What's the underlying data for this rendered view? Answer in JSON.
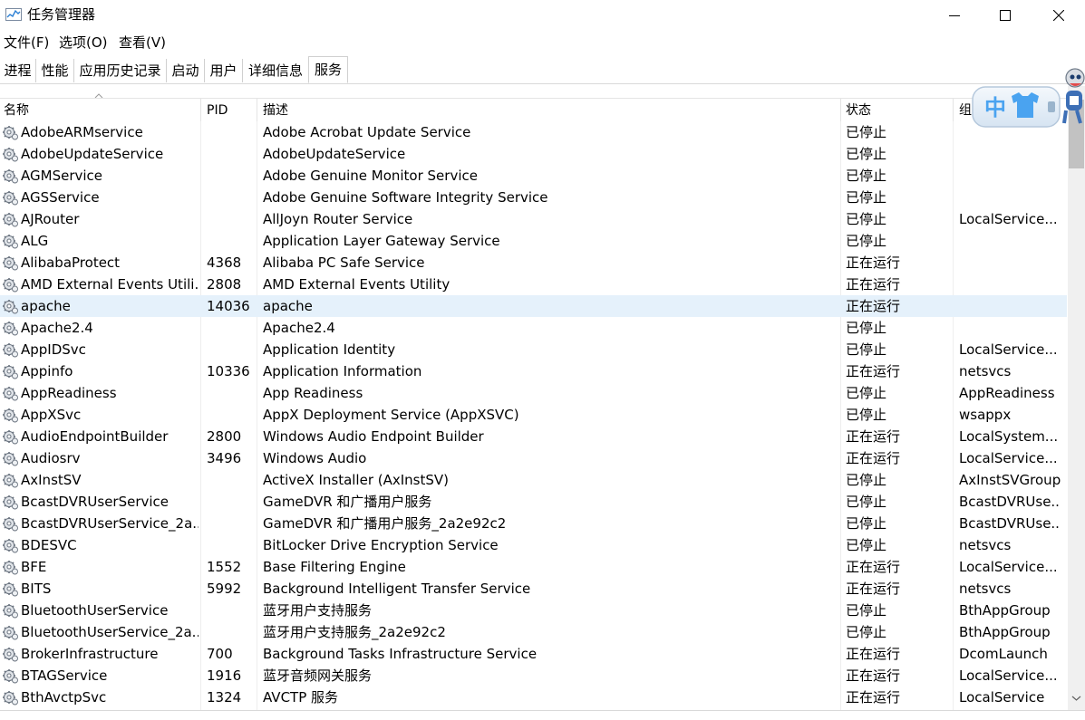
{
  "window": {
    "title": "任务管理器",
    "icon": "task-manager-icon",
    "controls": [
      "minimize-icon",
      "maximize-icon",
      "close-icon"
    ]
  },
  "menu": [
    {
      "label": "文件(F)"
    },
    {
      "label": "选项(O)"
    },
    {
      "label": "查看(V)"
    }
  ],
  "tabs": [
    {
      "label": "进程"
    },
    {
      "label": "性能"
    },
    {
      "label": "应用历史记录"
    },
    {
      "label": "启动"
    },
    {
      "label": "用户"
    },
    {
      "label": "详细信息"
    },
    {
      "label": "服务",
      "active": true
    }
  ],
  "columns": [
    "名称",
    "PID",
    "描述",
    "状态",
    "组"
  ],
  "sort": {
    "column": "名称",
    "direction": "ascending"
  },
  "ime_widget": {
    "label": "中"
  },
  "colors": {
    "selected_row": "#e5f1fb",
    "ime_blue": "#4aa3f0"
  },
  "services": [
    {
      "name": "AdobeARMservice",
      "pid": "",
      "desc": "Adobe Acrobat Update Service",
      "status": "已停止",
      "group": ""
    },
    {
      "name": "AdobeUpdateService",
      "pid": "",
      "desc": "AdobeUpdateService",
      "status": "已停止",
      "group": ""
    },
    {
      "name": "AGMService",
      "pid": "",
      "desc": "Adobe Genuine Monitor Service",
      "status": "已停止",
      "group": ""
    },
    {
      "name": "AGSService",
      "pid": "",
      "desc": "Adobe Genuine Software Integrity Service",
      "status": "已停止",
      "group": ""
    },
    {
      "name": "AJRouter",
      "pid": "",
      "desc": "AllJoyn Router Service",
      "status": "已停止",
      "group": "LocalService..."
    },
    {
      "name": "ALG",
      "pid": "",
      "desc": "Application Layer Gateway Service",
      "status": "已停止",
      "group": ""
    },
    {
      "name": "AlibabaProtect",
      "pid": "4368",
      "desc": "Alibaba PC Safe Service",
      "status": "正在运行",
      "group": ""
    },
    {
      "name": "AMD External Events Utili...",
      "pid": "2808",
      "desc": "AMD External Events Utility",
      "status": "正在运行",
      "group": ""
    },
    {
      "name": "apache",
      "pid": "14036",
      "desc": "apache",
      "status": "正在运行",
      "group": "",
      "selected": true
    },
    {
      "name": "Apache2.4",
      "pid": "",
      "desc": "Apache2.4",
      "status": "已停止",
      "group": ""
    },
    {
      "name": "AppIDSvc",
      "pid": "",
      "desc": "Application Identity",
      "status": "已停止",
      "group": "LocalService..."
    },
    {
      "name": "Appinfo",
      "pid": "10336",
      "desc": "Application Information",
      "status": "正在运行",
      "group": "netsvcs"
    },
    {
      "name": "AppReadiness",
      "pid": "",
      "desc": "App Readiness",
      "status": "已停止",
      "group": "AppReadiness"
    },
    {
      "name": "AppXSvc",
      "pid": "",
      "desc": "AppX Deployment Service (AppXSVC)",
      "status": "已停止",
      "group": "wsappx"
    },
    {
      "name": "AudioEndpointBuilder",
      "pid": "2800",
      "desc": "Windows Audio Endpoint Builder",
      "status": "正在运行",
      "group": "LocalSystem..."
    },
    {
      "name": "Audiosrv",
      "pid": "3496",
      "desc": "Windows Audio",
      "status": "正在运行",
      "group": "LocalService..."
    },
    {
      "name": "AxInstSV",
      "pid": "",
      "desc": "ActiveX Installer (AxInstSV)",
      "status": "已停止",
      "group": "AxInstSVGroup"
    },
    {
      "name": "BcastDVRUserService",
      "pid": "",
      "desc": "GameDVR 和广播用户服务",
      "status": "已停止",
      "group": "BcastDVRUse..."
    },
    {
      "name": "BcastDVRUserService_2a...",
      "pid": "",
      "desc": "GameDVR 和广播用户服务_2a2e92c2",
      "status": "已停止",
      "group": "BcastDVRUse..."
    },
    {
      "name": "BDESVC",
      "pid": "",
      "desc": "BitLocker Drive Encryption Service",
      "status": "已停止",
      "group": "netsvcs"
    },
    {
      "name": "BFE",
      "pid": "1552",
      "desc": "Base Filtering Engine",
      "status": "正在运行",
      "group": "LocalService..."
    },
    {
      "name": "BITS",
      "pid": "5992",
      "desc": "Background Intelligent Transfer Service",
      "status": "正在运行",
      "group": "netsvcs"
    },
    {
      "name": "BluetoothUserService",
      "pid": "",
      "desc": "蓝牙用户支持服务",
      "status": "已停止",
      "group": "BthAppGroup"
    },
    {
      "name": "BluetoothUserService_2a...",
      "pid": "",
      "desc": "蓝牙用户支持服务_2a2e92c2",
      "status": "已停止",
      "group": "BthAppGroup"
    },
    {
      "name": "BrokerInfrastructure",
      "pid": "700",
      "desc": "Background Tasks Infrastructure Service",
      "status": "正在运行",
      "group": "DcomLaunch"
    },
    {
      "name": "BTAGService",
      "pid": "1916",
      "desc": "蓝牙音频网关服务",
      "status": "正在运行",
      "group": "LocalService..."
    },
    {
      "name": "BthAvctpSvc",
      "pid": "1324",
      "desc": "AVCTP 服务",
      "status": "正在运行",
      "group": "LocalService"
    }
  ]
}
